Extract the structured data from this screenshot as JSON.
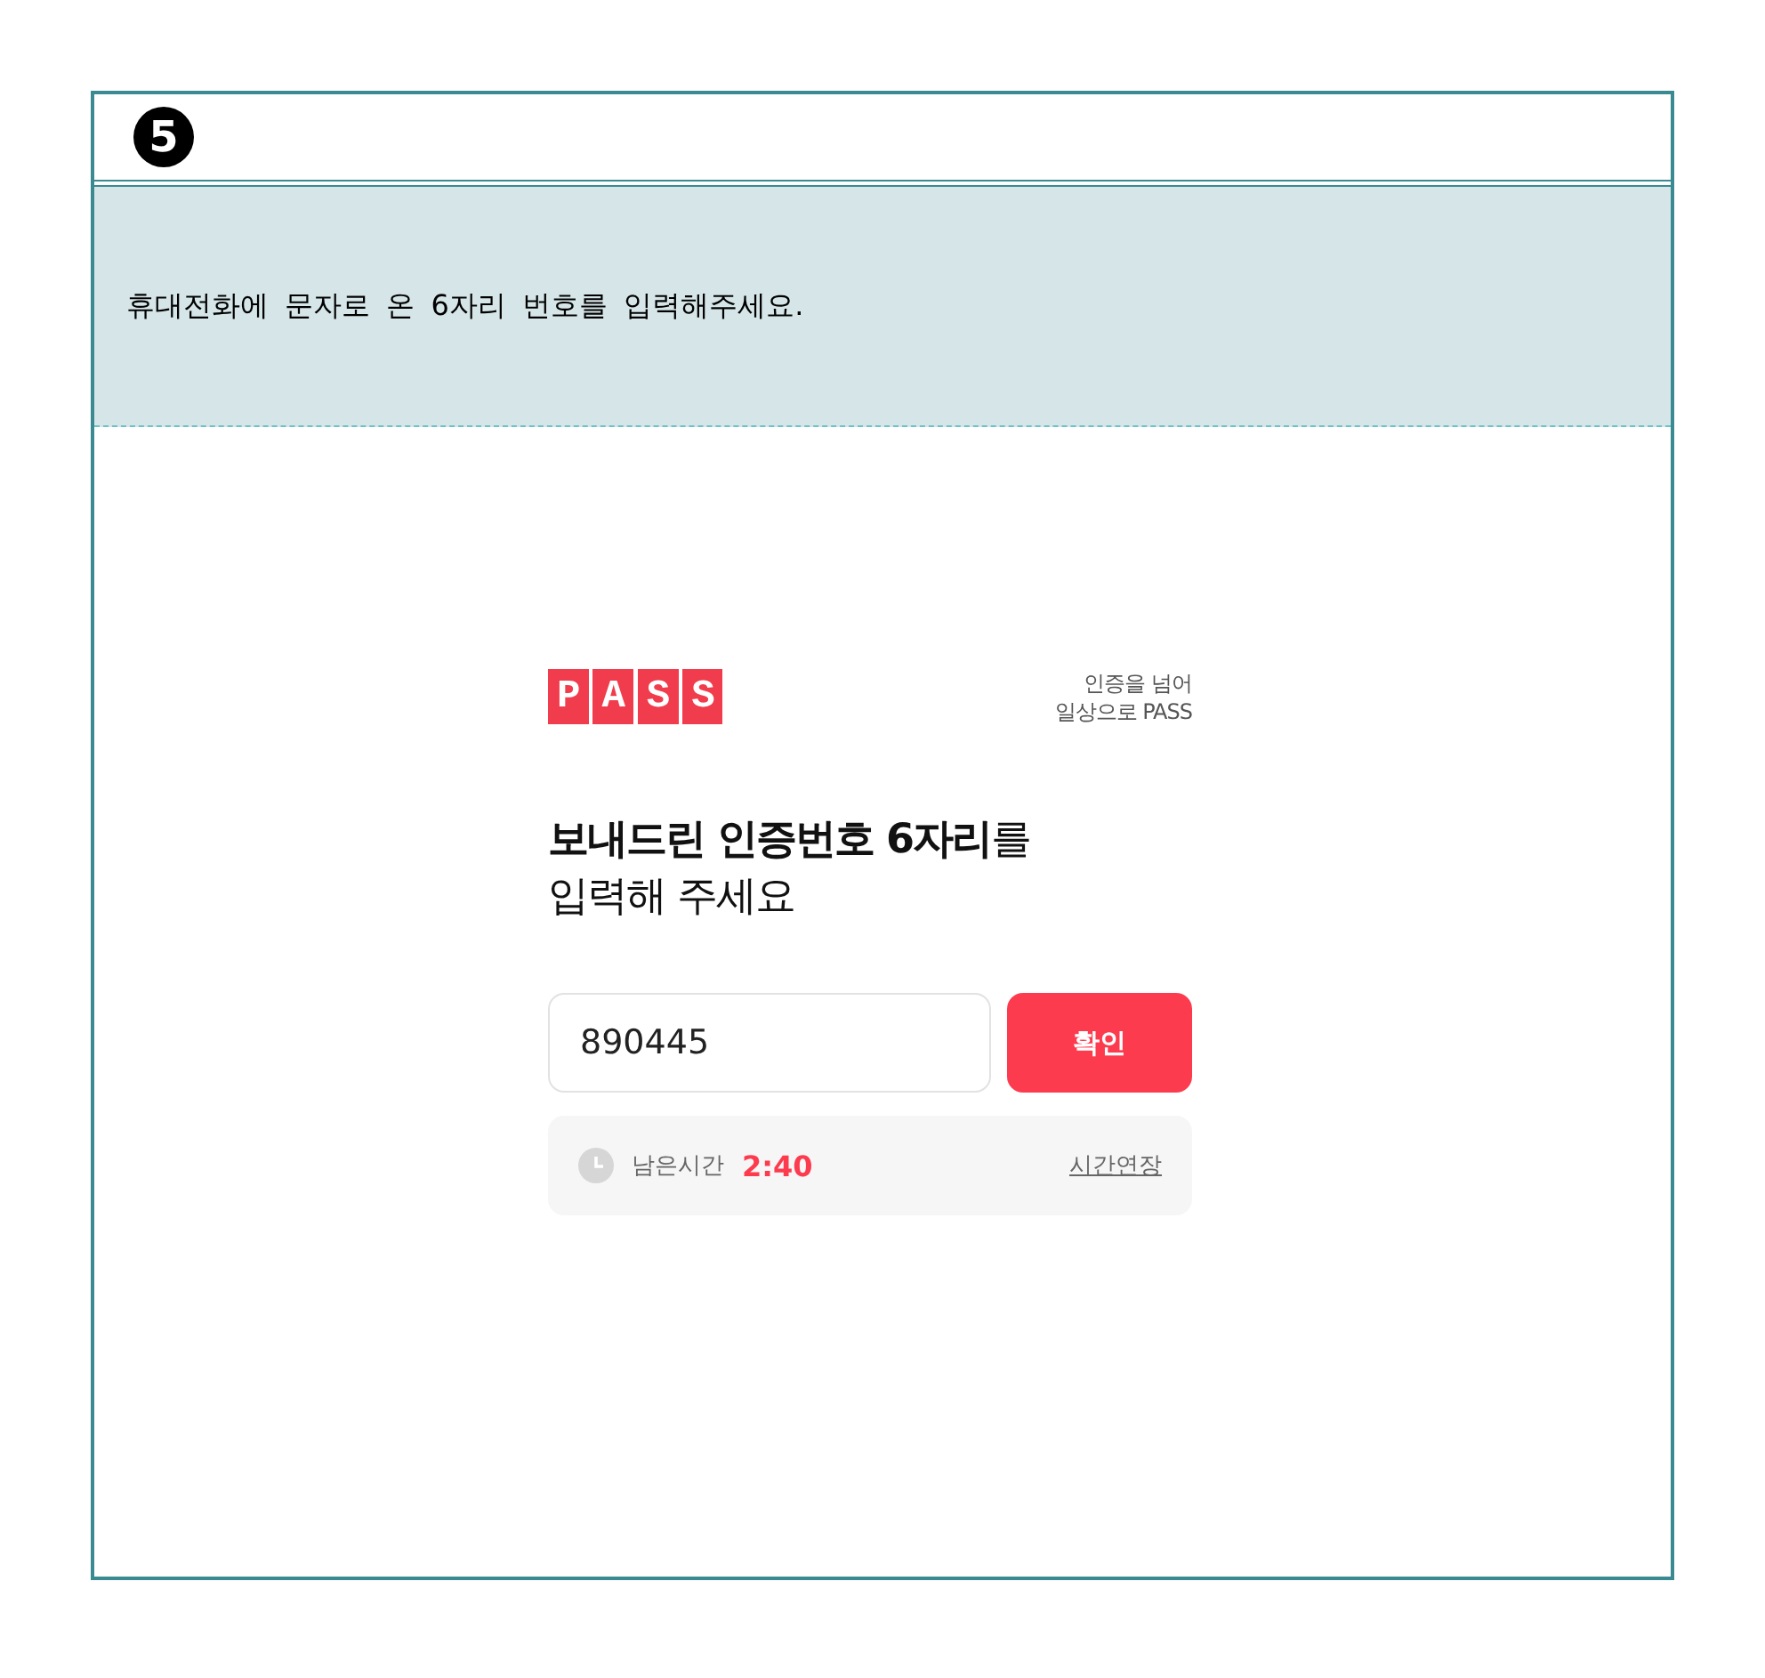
{
  "step": {
    "number": "5"
  },
  "instruction": "휴대전화에 문자로 온 6자리 번호를 입력해주세요.",
  "card": {
    "logo": "PASS",
    "slogan": [
      "인증을 넘어",
      "일상으로 PASS"
    ],
    "heading": [
      "**보내드린 인증번호 6자리**를",
      "입력해 주세요"
    ],
    "code_field": {
      "value": "890445"
    },
    "confirm_button": "확인",
    "timer": {
      "label": "남은시간",
      "time": "2:40",
      "extend_link": "시간연장"
    }
  }
}
